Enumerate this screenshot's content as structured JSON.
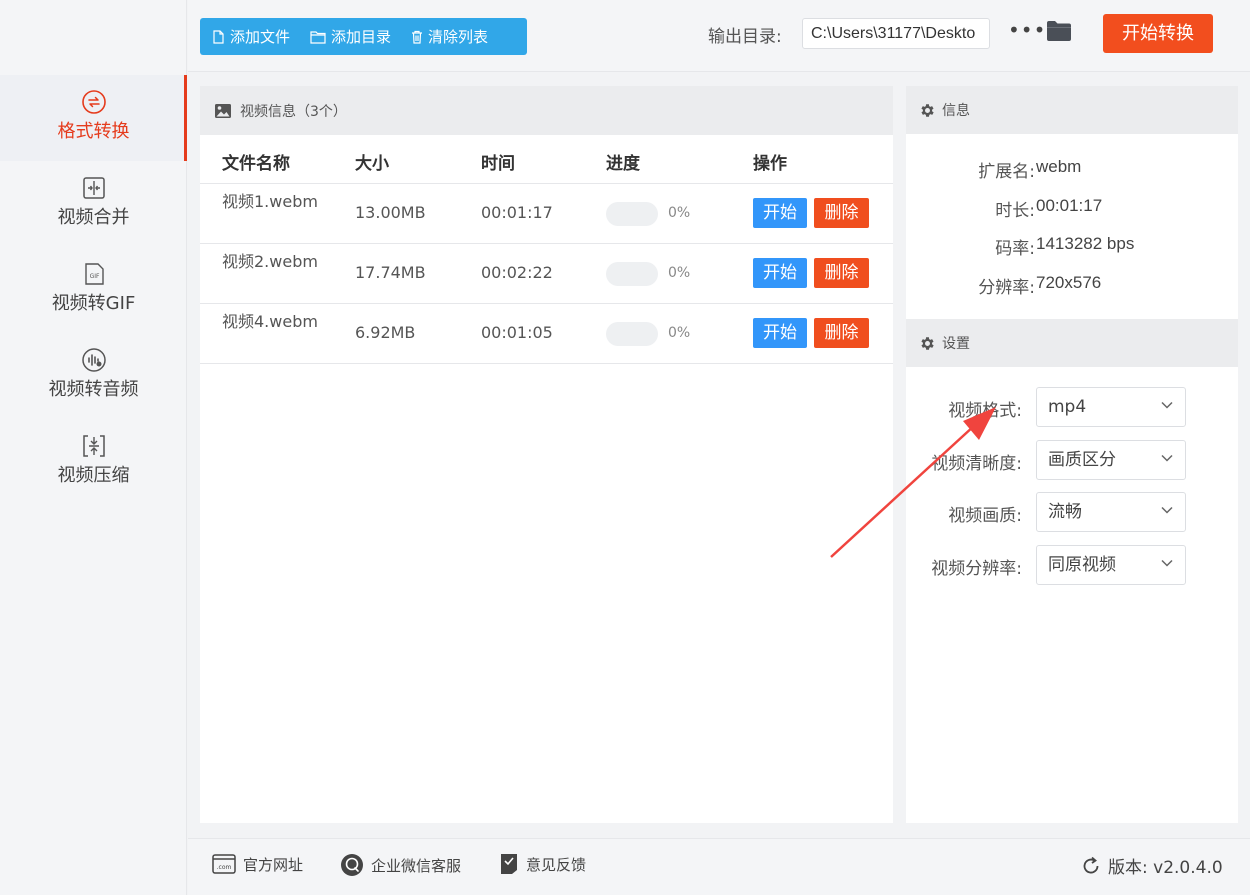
{
  "sidebar": {
    "items": [
      {
        "label": "格式转换",
        "icon": "format-convert-icon",
        "active": true
      },
      {
        "label": "视频合并",
        "icon": "merge-icon",
        "active": false
      },
      {
        "label": "视频转GIF",
        "icon": "gif-icon",
        "active": false
      },
      {
        "label": "视频转音频",
        "icon": "audio-icon",
        "active": false
      },
      {
        "label": "视频压缩",
        "icon": "compress-icon",
        "active": false
      }
    ]
  },
  "toolbar": {
    "add_file": "添加文件",
    "add_dir": "添加目录",
    "clear_list": "清除列表",
    "output_label": "输出目录:",
    "output_path": "C:\\Users\\31177\\Deskto",
    "more": "•••",
    "start_all": "开始转换"
  },
  "video_panel": {
    "title": "视频信息（3个）",
    "columns": [
      "文件名称",
      "大小",
      "时间",
      "进度",
      "操作"
    ],
    "rows": [
      {
        "name": "视频1.webm",
        "size": "13.00MB",
        "time": "00:01:17",
        "progress": 0,
        "progress_text": "0%",
        "start": "开始",
        "delete": "删除"
      },
      {
        "name": "视频2.webm",
        "size": "17.74MB",
        "time": "00:02:22",
        "progress": 0,
        "progress_text": "0%",
        "start": "开始",
        "delete": "删除"
      },
      {
        "name": "视频4.webm",
        "size": "6.92MB",
        "time": "00:01:05",
        "progress": 0,
        "progress_text": "0%",
        "start": "开始",
        "delete": "删除"
      }
    ]
  },
  "info_panel": {
    "title": "信息",
    "fields": [
      {
        "key": "扩展名:",
        "value": "webm"
      },
      {
        "key": "时长:",
        "value": "00:01:17"
      },
      {
        "key": "码率:",
        "value": "1413282 bps"
      },
      {
        "key": "分辨率:",
        "value": "720x576"
      }
    ]
  },
  "settings_panel": {
    "title": "设置",
    "fields": [
      {
        "key": "视频格式:",
        "value": "mp4"
      },
      {
        "key": "视频清晰度:",
        "value": "画质区分"
      },
      {
        "key": "视频画质:",
        "value": "流畅"
      },
      {
        "key": "视频分辨率:",
        "value": "同原视频"
      }
    ]
  },
  "footer": {
    "website": "官方网址",
    "wechat": "企业微信客服",
    "feedback": "意见反馈",
    "version": "版本: v2.0.4.0"
  },
  "colors": {
    "accent_blue": "#31a7e8",
    "start_red": "#f24e1e",
    "active_red": "#e53b1c",
    "row_start_blue": "#3296fa"
  }
}
